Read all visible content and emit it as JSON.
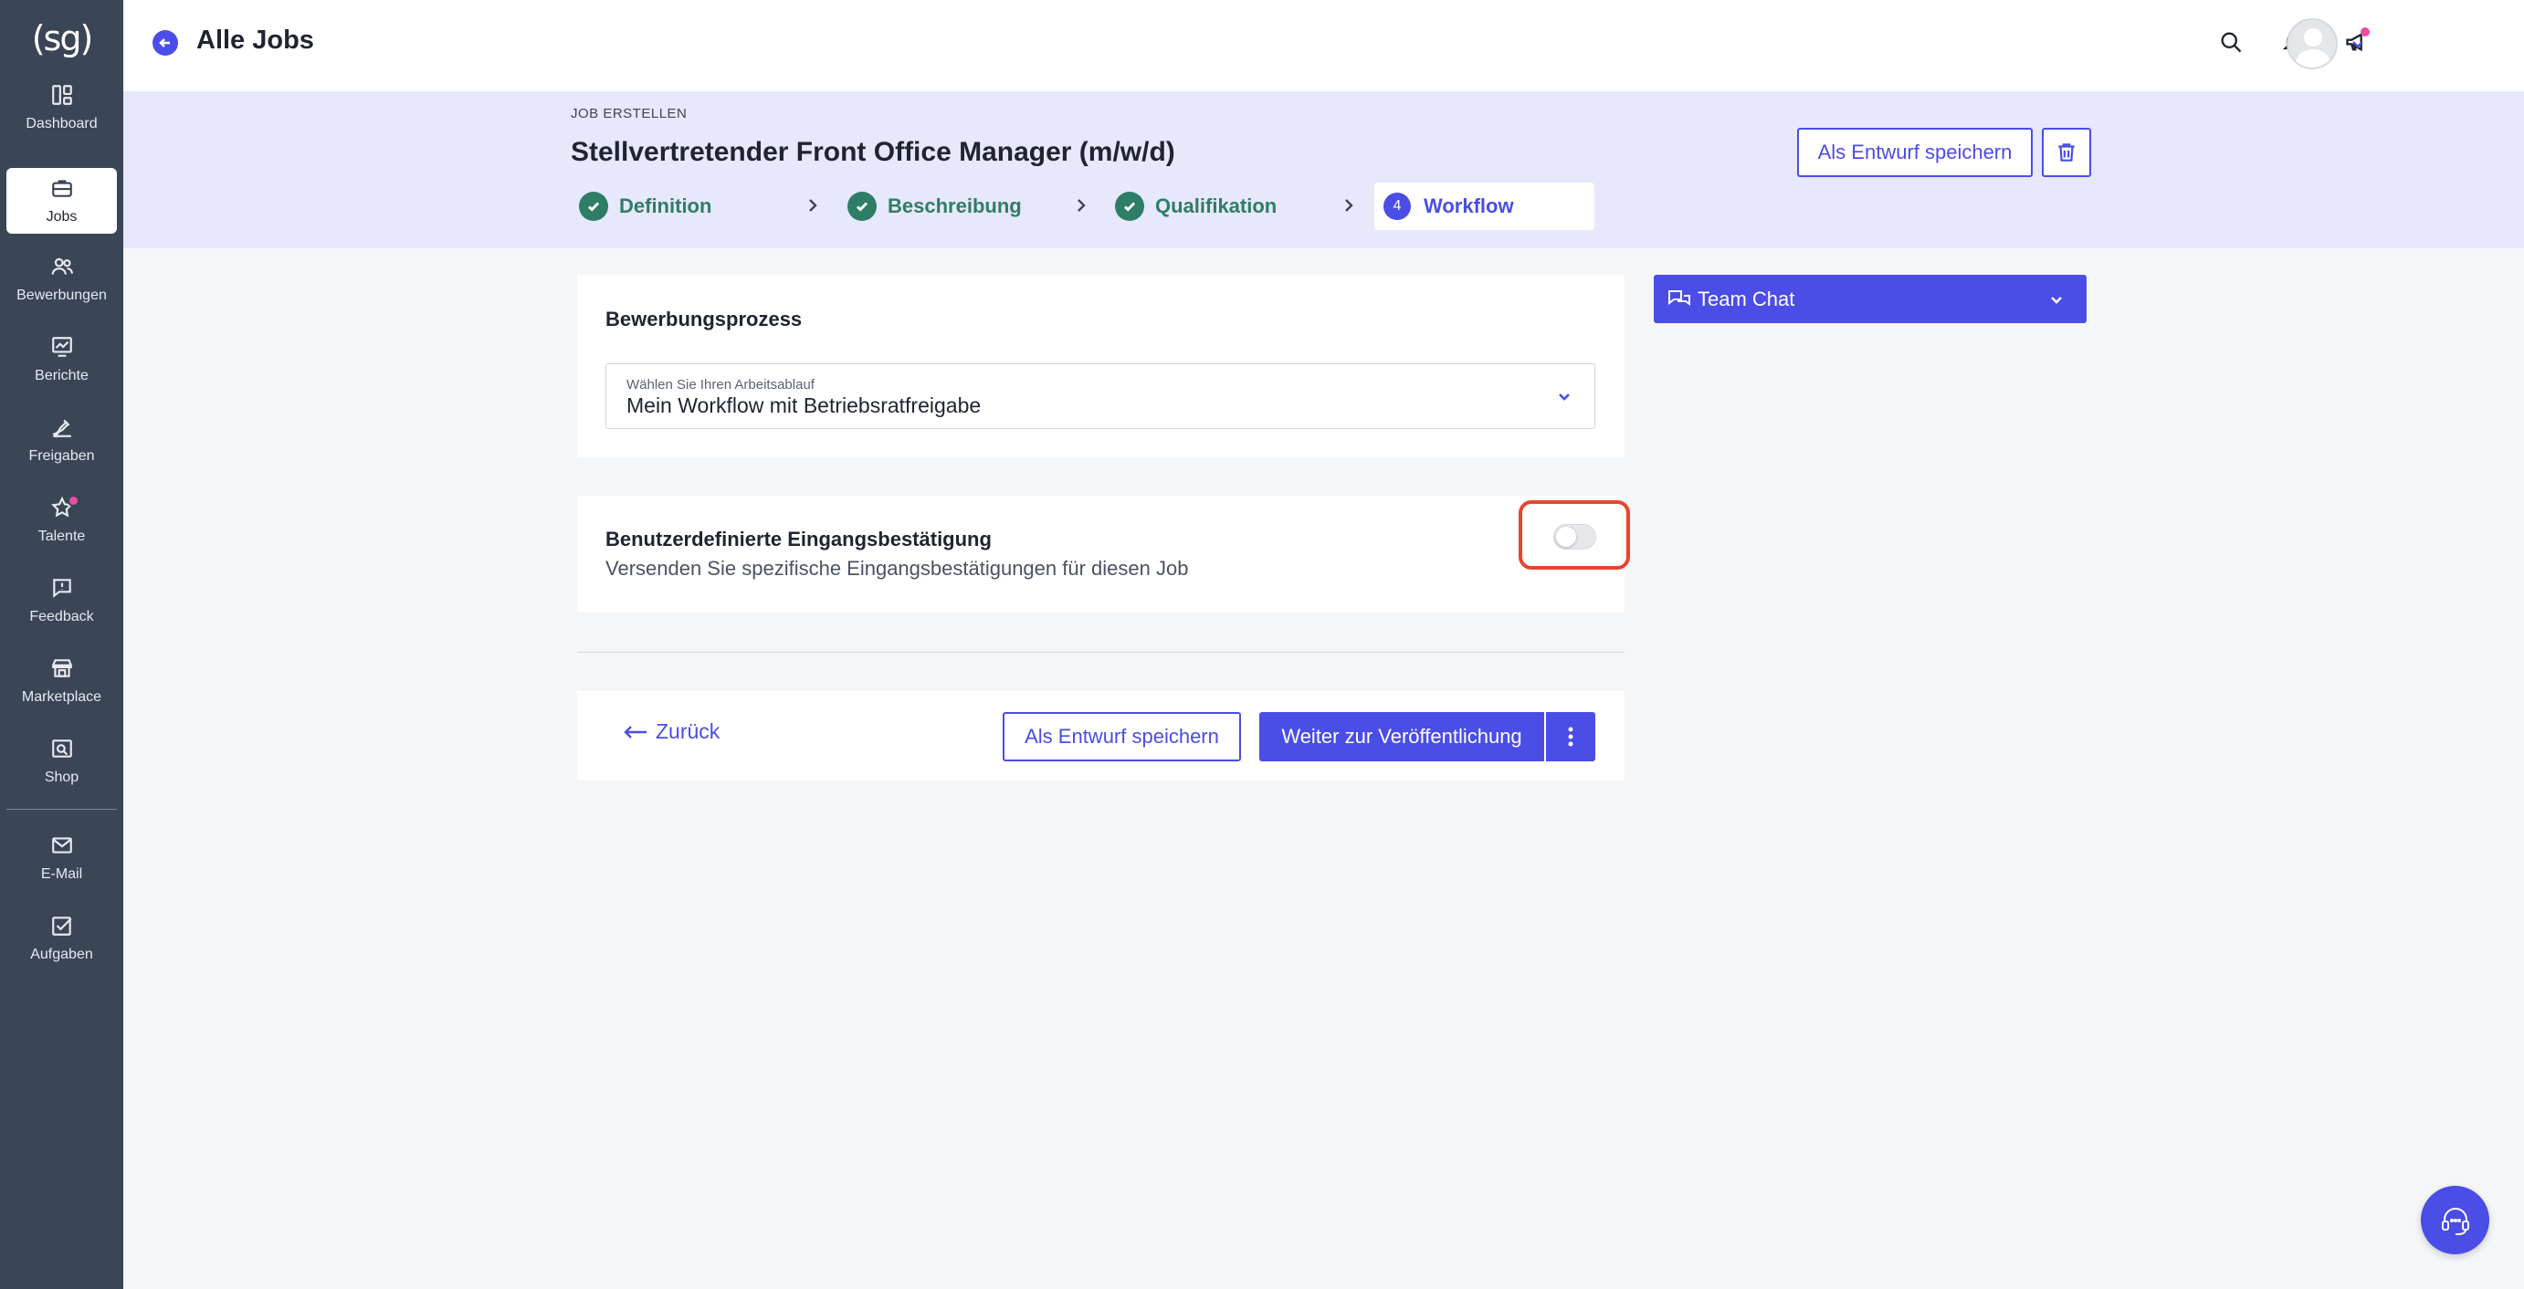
{
  "brand": {
    "logo_text": "(sg)"
  },
  "colors": {
    "sidebar_bg": "#3a4556",
    "accent": "#4a4de6",
    "success": "#2e7d66",
    "band_bg": "#e7e8fb",
    "highlight": "#e8452c",
    "notification_dot": "#f04aa6"
  },
  "sidebar": {
    "items": [
      {
        "label": "Dashboard",
        "icon": "dashboard-icon",
        "active": false
      },
      {
        "label": "Jobs",
        "icon": "briefcase-icon",
        "active": true
      },
      {
        "label": "Bewerbungen",
        "icon": "users-icon",
        "active": false
      },
      {
        "label": "Berichte",
        "icon": "chart-icon",
        "active": false
      },
      {
        "label": "Freigaben",
        "icon": "approval-icon",
        "active": false
      },
      {
        "label": "Talente",
        "icon": "star-icon",
        "active": false,
        "badge_dot": true
      },
      {
        "label": "Feedback",
        "icon": "feedback-icon",
        "active": false
      },
      {
        "label": "Marketplace",
        "icon": "store-icon",
        "active": false
      },
      {
        "label": "Shop",
        "icon": "shop-icon",
        "active": false
      },
      {
        "label": "E-Mail",
        "icon": "mail-icon",
        "active": false
      },
      {
        "label": "Aufgaben",
        "icon": "tasks-icon",
        "active": false
      }
    ]
  },
  "header": {
    "title": "Alle Jobs",
    "icons": [
      "search-icon",
      "bell-icon",
      "megaphone-icon",
      "avatar",
      "chevron-down-icon"
    ]
  },
  "job": {
    "eyebrow": "JOB ERSTELLEN",
    "title": "Stellvertretender Front Office Manager (m/w/d)",
    "save_draft_label": "Als Entwurf speichern"
  },
  "steps": [
    {
      "label": "Definition",
      "status": "done"
    },
    {
      "label": "Beschreibung",
      "status": "done"
    },
    {
      "label": "Qualifikation",
      "status": "done"
    },
    {
      "number": "4",
      "label": "Workflow",
      "status": "current"
    }
  ],
  "process_card": {
    "title": "Bewerbungsprozess",
    "select_label": "Wählen Sie Ihren Arbeitsablauf",
    "select_value": "Mein Workflow mit Betriebsratfreigabe"
  },
  "confirmation_card": {
    "title": "Benutzerdefinierte Eingangsbestätigung",
    "subtitle": "Versenden Sie spezifische Eingangsbestätigungen für diesen Job",
    "toggle_on": false
  },
  "footer_actions": {
    "back_label": "Zurück",
    "save_draft_label": "Als Entwurf speichern",
    "next_label": "Weiter zur Veröffentlichung"
  },
  "team_chat": {
    "label": "Team Chat"
  }
}
